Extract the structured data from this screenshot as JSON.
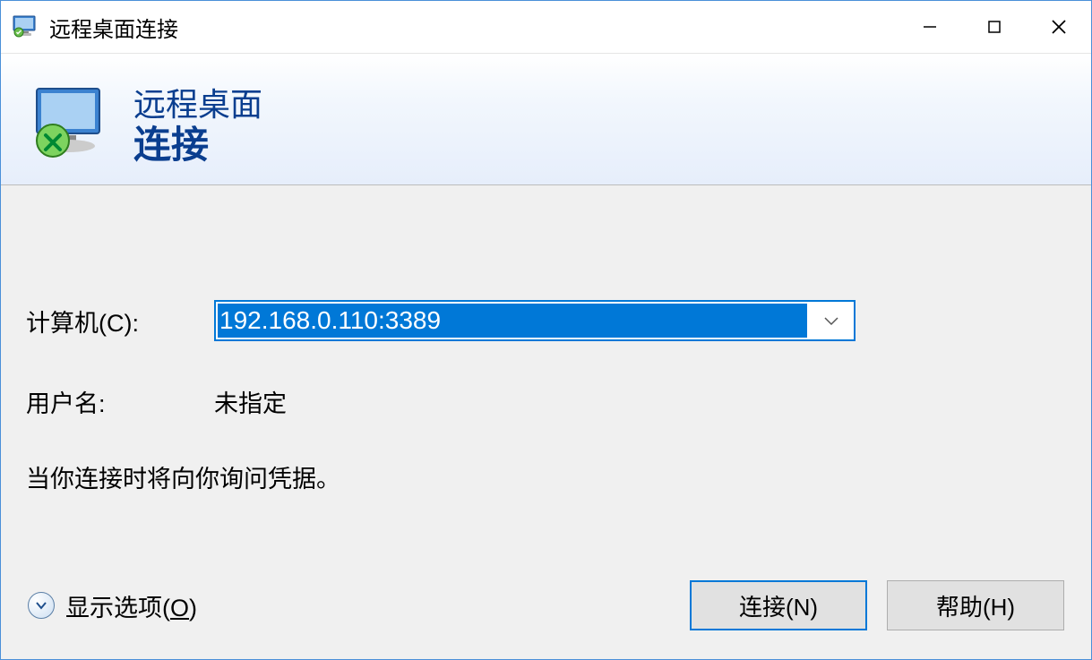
{
  "titlebar": {
    "title": "远程桌面连接"
  },
  "header": {
    "line1": "远程桌面",
    "line2": "连接"
  },
  "form": {
    "computer_label": "计算机(C):",
    "computer_value": "192.168.0.110:3389",
    "username_label": "用户名:",
    "username_value": "未指定",
    "info_text": "当你连接时将向你询问凭据。"
  },
  "footer": {
    "show_options_prefix": "显示选项(",
    "show_options_hotkey": "O",
    "show_options_suffix": ")",
    "connect_label": "连接(N)",
    "help_label": "帮助(H)"
  }
}
